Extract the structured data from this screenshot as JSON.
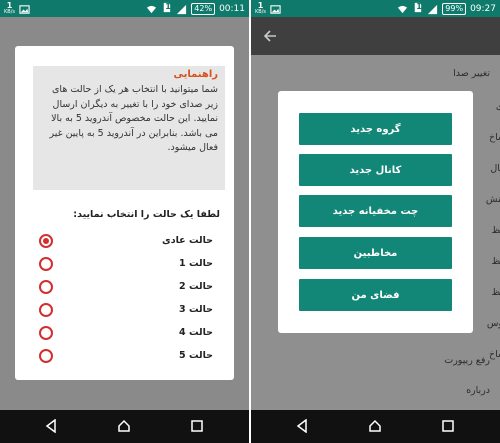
{
  "left_screen": {
    "status": {
      "speed_value": "1",
      "speed_unit": "KB/s",
      "sim": "1",
      "battery": "42%",
      "time": "00:11"
    },
    "help": {
      "title": "راهنمایی",
      "text": "شما میتوانید با انتخاب هر یک از حالت های زیر صدای خود را با تغییر به دیگران ارسال نمایید. این حالت مخصوص آندروید 5 به بالا می باشد. بنابراین در آندروید 5 به پایین غیر فعال میشود."
    },
    "prompt": "لطفا یک حالت را انتخاب نمایید:",
    "options": [
      {
        "label": "حالت عادی",
        "selected": true
      },
      {
        "label": "حالت 1",
        "selected": false
      },
      {
        "label": "حالت 2",
        "selected": false
      },
      {
        "label": "حالت 3",
        "selected": false
      },
      {
        "label": "حالت 4",
        "selected": false
      },
      {
        "label": "حالت 5",
        "selected": false
      }
    ]
  },
  "right_screen": {
    "status": {
      "speed_value": "1",
      "speed_unit": "KB/s",
      "sim": "1",
      "battery": "99%",
      "time": "09:27"
    },
    "menu": {
      "top_item": "تغییر صدا",
      "bottom_items": [
        "رفع ریپورت",
        "درباره"
      ],
      "cut_fragments": [
        "آی",
        "ساخ",
        "حال",
        "منش",
        "تنظ",
        "تنظ",
        "تنظ",
        "پوس",
        "ساخ"
      ]
    },
    "popup": {
      "buttons": [
        "گروه جدید",
        "کانال جدید",
        "چت مخفیانه جدید",
        "مخاطبین",
        "فضای من"
      ]
    }
  },
  "colors": {
    "primary": "#128777",
    "statusbar": "#0f7a6b",
    "accent_red": "#d32f2f",
    "help_title": "#d9501f"
  },
  "icons": {
    "status": [
      "image-icon",
      "wifi-icon",
      "sim-icon",
      "signal-icon",
      "battery-icon"
    ],
    "nav": [
      "back-icon",
      "home-icon",
      "recents-icon"
    ],
    "appbar": "arrow-back-icon"
  }
}
